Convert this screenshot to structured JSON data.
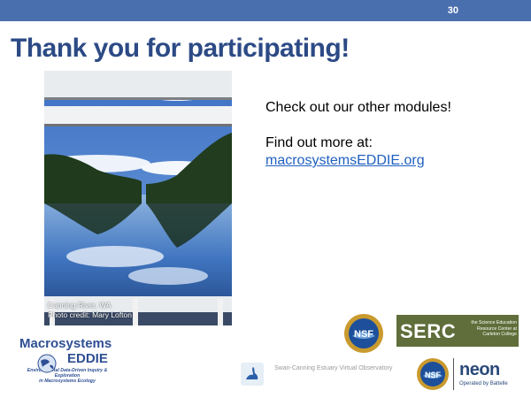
{
  "slide_number": "30",
  "title": "Thank you for participating!",
  "photo": {
    "caption_line1": "Canning River, WA",
    "caption_line2": "Photo credit: Mary Lofton"
  },
  "body": {
    "line1": "Check out our other modules!",
    "line2": "Find out more at:",
    "link_text": "macrosystemsEDDIE.org"
  },
  "logos": {
    "eddie_line1": "Macrosystems",
    "eddie_line2": "EDDIE",
    "eddie_tagline1": "Environmental Data-Driven Inquiry & Exploration",
    "eddie_tagline2": "in Macrosystems Ecology",
    "serc_big": "SERC",
    "serc_small": "the Science Education Resource Center at Carleton College",
    "observatory": "Swan-Canning Estuary Virtual Observatory",
    "neon_word": "neon",
    "neon_operated": "Operated by Battelle",
    "nsf_text": "NSF"
  },
  "colors": {
    "top_bar": "#4a6fae",
    "title": "#2c4a85",
    "link": "#1f5fbf",
    "serc_bg": "#5f6e3a"
  }
}
